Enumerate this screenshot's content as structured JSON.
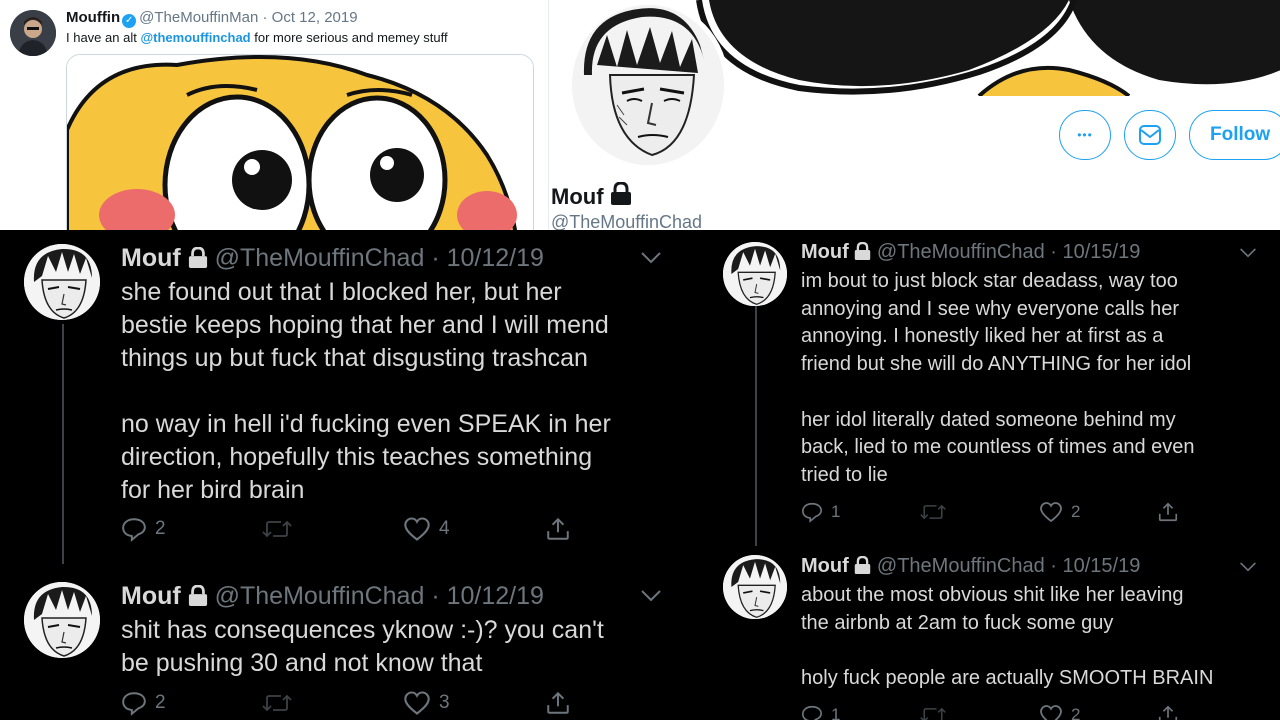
{
  "top_left_tweet": {
    "name": "Mouffin",
    "handle": "@TheMouffinMan",
    "date": "Oct 12, 2019",
    "text_before": "I have an alt ",
    "mention": "@themouffinchad",
    "text_after": " for more serious and memey stuff"
  },
  "profile": {
    "name": "Mouf",
    "handle": "@TheMouffinChad",
    "more_icon": "•••",
    "follow_label": "Follow"
  },
  "left_tweets": [
    {
      "name": "Mouf",
      "handle": "@TheMouffinChad",
      "date": "10/12/19",
      "lines": [
        "she found out that I blocked her, but her",
        "bestie keeps hoping that her and I will mend",
        "things up but fuck that disgusting trashcan",
        "",
        "no way in hell i'd fucking even SPEAK in her",
        "direction, hopefully this teaches something",
        "for her bird brain"
      ],
      "replies": "2",
      "retweets": "",
      "likes": "4"
    },
    {
      "name": "Mouf",
      "handle": "@TheMouffinChad",
      "date": "10/12/19",
      "lines": [
        "shit has consequences yknow :-)? you can't",
        "be pushing 30 and not know that"
      ],
      "replies": "2",
      "retweets": "",
      "likes": "3"
    }
  ],
  "right_tweets": [
    {
      "name": "Mouf",
      "handle": "@TheMouffinChad",
      "date": "10/15/19",
      "lines": [
        "im bout to just block star deadass, way too",
        "annoying and I see why everyone calls her",
        "annoying. I honestly liked her at first as a",
        "friend but she will do ANYTHING for her idol",
        "",
        "her idol literally dated someone behind my",
        "back, lied to me countless of times and even",
        "tried to lie"
      ],
      "replies": "1",
      "retweets": "",
      "likes": "2"
    },
    {
      "name": "Mouf",
      "handle": "@TheMouffinChad",
      "date": "10/15/19",
      "lines": [
        "about the most obvious shit like her leaving",
        "the airbnb at 2am to fuck some guy",
        "",
        "holy fuck people are actually SMOOTH BRAIN"
      ],
      "replies": "1",
      "retweets": "",
      "likes": "2"
    }
  ],
  "colors": {
    "accent": "#1da1f2",
    "dark_bg": "#000000",
    "dark_text": "#d9d9d9",
    "muted": "#6e767d",
    "mention": "#1b95e0"
  },
  "icons": [
    "verified-icon",
    "lock-icon",
    "chevron-down-icon",
    "reply-icon",
    "retweet-icon",
    "like-icon",
    "share-icon",
    "more-icon",
    "envelope-icon"
  ]
}
